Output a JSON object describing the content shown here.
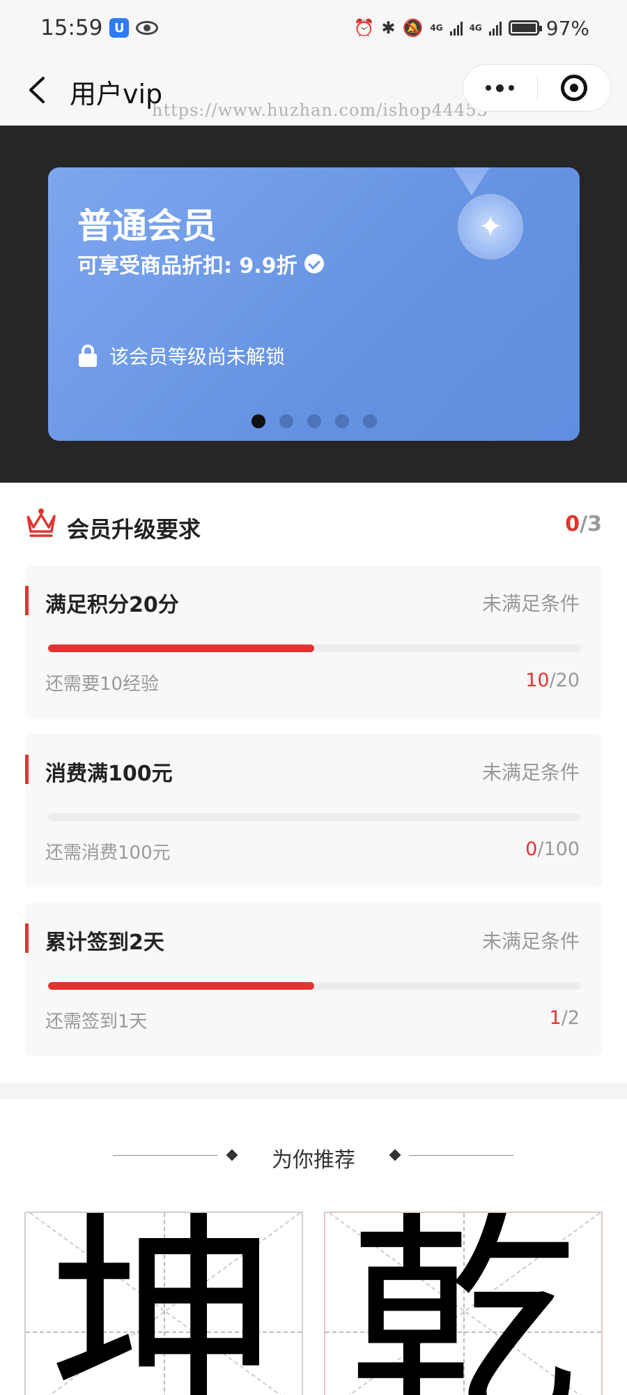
{
  "status_bar": {
    "time": "15:59",
    "network_left": "4G",
    "network_right": "4G",
    "battery": "97%",
    "icons": [
      "app-badge-icon",
      "eye-icon",
      "alarm-icon",
      "bluetooth-icon",
      "mute-icon",
      "signal-icon",
      "battery-icon"
    ]
  },
  "nav": {
    "title": "用户vip",
    "watermark": "https://www.huzhan.com/ishop44453"
  },
  "vip_card": {
    "level_name": "普通会员",
    "discount_text": "可享受商品折扣: 9.9折",
    "lock_text": "该会员等级尚未解锁",
    "dots_total": 5,
    "active_dot": 1,
    "colors": {
      "card": "#6a97e4"
    }
  },
  "requirements": {
    "title": "会员升级要求",
    "met": "0",
    "total": "/3",
    "items": [
      {
        "name": "满足积分20分",
        "status": "未满足条件",
        "hint": "还需要10经验",
        "current": "10",
        "target": "/20",
        "progress": 0.5
      },
      {
        "name": "消费满100元",
        "status": "未满足条件",
        "hint": "还需消费100元",
        "current": "0",
        "target": "/100",
        "progress": 0
      },
      {
        "name": "累计签到2天",
        "status": "未满足条件",
        "hint": "还需签到1天",
        "current": "1",
        "target": "/2",
        "progress": 0.5
      }
    ],
    "colors": {
      "accent": "#e1342f"
    }
  },
  "recommend": {
    "title": "为你推荐",
    "products": [
      {
        "glyph": "坤"
      },
      {
        "glyph": "乾"
      }
    ]
  }
}
